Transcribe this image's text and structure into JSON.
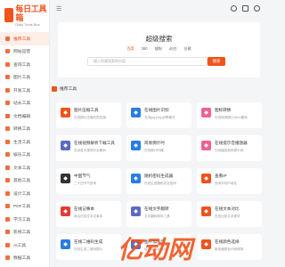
{
  "logo": {
    "main": "每日工具箱",
    "sub": "Daily Tools Box"
  },
  "sidebar": {
    "items": [
      {
        "label": "推荐工具",
        "active": true
      },
      {
        "label": "网站运营"
      },
      {
        "label": "查询工具"
      },
      {
        "label": "图片工具"
      },
      {
        "label": "开发工具"
      },
      {
        "label": "站长工具"
      },
      {
        "label": "文档编辑"
      },
      {
        "label": "转换工具"
      },
      {
        "label": "生活工具"
      },
      {
        "label": "娱乐工具"
      },
      {
        "label": "文本工具"
      },
      {
        "label": "其他工具"
      },
      {
        "label": "设计工具"
      },
      {
        "label": "PDF工具"
      },
      {
        "label": "学习工具"
      },
      {
        "label": "影视工具"
      },
      {
        "label": "AI工具"
      },
      {
        "label": "数据工具"
      }
    ]
  },
  "topbar": {
    "menu_icon": "menu-icon"
  },
  "search": {
    "title": "超级搜索",
    "engines": [
      "百度",
      "360",
      "搜狗",
      "必应",
      "谷歌"
    ],
    "selected": 0,
    "placeholder": "输入你要搜索的内容",
    "button_label": "搜索"
  },
  "section": {
    "title": "推荐工具"
  },
  "tools": [
    {
      "title": "图片压缩工具",
      "desc": "在线图片压缩无损压缩",
      "color": "#f0531c",
      "icon": "image-icon"
    },
    {
      "title": "在线图片识别",
      "desc": "支持jpg,png,gif等格式",
      "color": "#2a7de1",
      "icon": "scan-icon"
    },
    {
      "title": "图标转换",
      "desc": "在线转换图片为ico图标",
      "color": "#f06292",
      "icon": "convert-icon"
    },
    {
      "title": "在线视频解析下载工具",
      "desc": "支持各大视频平台解析",
      "color": "#5c6bc0",
      "icon": "video-icon"
    },
    {
      "title": "简易倒计时",
      "desc": "在线倒计时器",
      "color": "#2a7de1",
      "icon": "timer-icon"
    },
    {
      "title": "在线提示音播放器",
      "desc": "在线播放各种提示音",
      "color": "#f06292",
      "icon": "audio-icon"
    },
    {
      "title": "中国节气",
      "desc": "二十四节气查询",
      "color": "#333333",
      "icon": "calendar-icon"
    },
    {
      "title": "随机密码生成器",
      "desc": "在线生成随机安全密码",
      "color": "#2a7de1",
      "icon": "key-icon"
    },
    {
      "title": "查看IP",
      "desc": "查询本机IP地址",
      "color": "#f0531c",
      "icon": "ip-icon"
    },
    {
      "title": "在线记事本",
      "desc": "简洁在线文本记事本",
      "color": "#e53935",
      "icon": "note-icon"
    },
    {
      "title": "在线文字翻转",
      "desc": "文字翻转倒序工具",
      "color": "#5c6bc0",
      "icon": "text-icon"
    },
    {
      "title": "在线文本对比",
      "desc": "在线比较文本差异",
      "color": "#f0531c",
      "icon": "compare-icon"
    },
    {
      "title": "在线二维码生成",
      "desc": "在线生成二维码图片",
      "color": "#2a7de1",
      "icon": "qrcode-icon"
    },
    {
      "title": "图片加水印",
      "desc": "给图片添加水印",
      "color": "#5c6bc0",
      "icon": "watermark-icon"
    },
    {
      "title": "在线颜色选择",
      "desc": "取色器颜色代码转换",
      "color": "#f0531c",
      "icon": "palette-icon"
    }
  ],
  "watermark": {
    "text": "亿动网"
  }
}
